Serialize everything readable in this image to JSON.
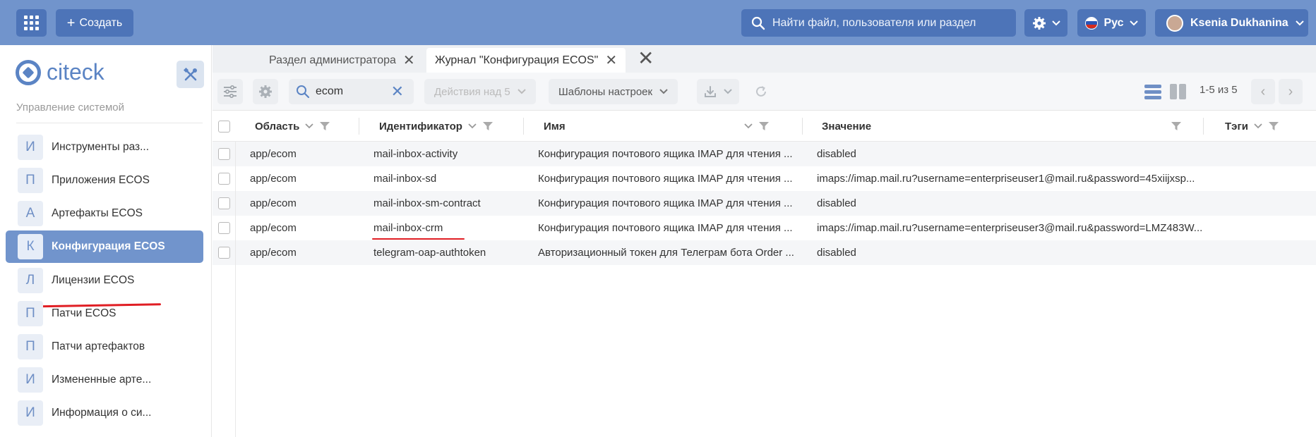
{
  "header": {
    "create_label": "Создать",
    "search_placeholder": "Найти файл, пользователя или раздел",
    "language": "Рус",
    "user_name": "Ksenia Dukhanina",
    "colors": {
      "header_bg": "#7194cc",
      "button_bg": "#4d74b8",
      "accent": "#5b84c4",
      "red_mark": "#e01e24"
    }
  },
  "sidebar": {
    "logo_text": "citeck",
    "subtitle": "Управление системой",
    "items": [
      {
        "letter": "И",
        "label": "Инструменты раз..."
      },
      {
        "letter": "П",
        "label": "Приложения ECOS"
      },
      {
        "letter": "А",
        "label": "Артефакты ECOS"
      },
      {
        "letter": "К",
        "label": "Конфигурация ECOS",
        "active": true
      },
      {
        "letter": "Л",
        "label": "Лицензии ECOS"
      },
      {
        "letter": "П",
        "label": "Патчи ECOS"
      },
      {
        "letter": "П",
        "label": "Патчи артефактов"
      },
      {
        "letter": "И",
        "label": "Измененные арте..."
      },
      {
        "letter": "И",
        "label": "Информация о си..."
      }
    ]
  },
  "tabs": [
    {
      "label": "Раздел администратора"
    },
    {
      "label": "Журнал \"Конфигурация ECOS\"",
      "active": true
    }
  ],
  "toolbar": {
    "search_value": "ecom",
    "actions_label": "Действия над 5",
    "templates_label": "Шаблоны настроек",
    "pagination": "1-5 из 5"
  },
  "table": {
    "columns": [
      "Область",
      "Идентификатор",
      "Имя",
      "Значение",
      "Тэги"
    ],
    "rows": [
      {
        "area": "app/ecom",
        "id": "mail-inbox-activity",
        "name": "Конфигурация почтового ящика IMAP для чтения ...",
        "value": "disabled"
      },
      {
        "area": "app/ecom",
        "id": "mail-inbox-sd",
        "name": "Конфигурация почтового ящика IMAP для чтения ...",
        "value": "imaps://imap.mail.ru?username=enterpriseuser1@mail.ru&password=45xiijxsp..."
      },
      {
        "area": "app/ecom",
        "id": "mail-inbox-sm-contract",
        "name": "Конфигурация почтового ящика IMAP для чтения ...",
        "value": "disabled"
      },
      {
        "area": "app/ecom",
        "id": "mail-inbox-crm",
        "name": "Конфигурация почтового ящика IMAP для чтения ...",
        "value": "imaps://imap.mail.ru?username=enterpriseuser3@mail.ru&password=LMZ483W..."
      },
      {
        "area": "app/ecom",
        "id": "telegram-oap-authtoken",
        "name": "Авторизационный токен для Телеграм бота Order ...",
        "value": "disabled"
      }
    ]
  }
}
